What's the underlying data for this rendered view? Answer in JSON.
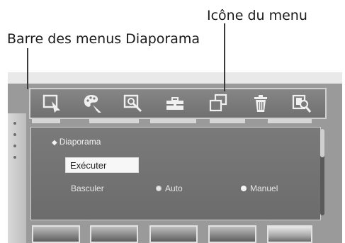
{
  "annotations": {
    "menu_icon_label": "Icône du menu",
    "menu_bar_label": "Barre des menus Diaporama"
  },
  "menubar": {
    "icons": [
      {
        "name": "select-image-icon"
      },
      {
        "name": "palette-icon"
      },
      {
        "name": "zoom-icon"
      },
      {
        "name": "toolbox-icon"
      },
      {
        "name": "slideshow-icon"
      },
      {
        "name": "trash-icon"
      },
      {
        "name": "search-image-icon"
      }
    ]
  },
  "dialog": {
    "title": "Diaporama",
    "execute_label": "Exécuter",
    "toggle_label": "Basculer",
    "options": [
      {
        "label": "Auto",
        "selected": false
      },
      {
        "label": "Manuel",
        "selected": true
      }
    ]
  },
  "colors": {
    "menubar": "#7a7a7a",
    "dialog": "#737373",
    "button_bg": "#f7f7f7"
  }
}
